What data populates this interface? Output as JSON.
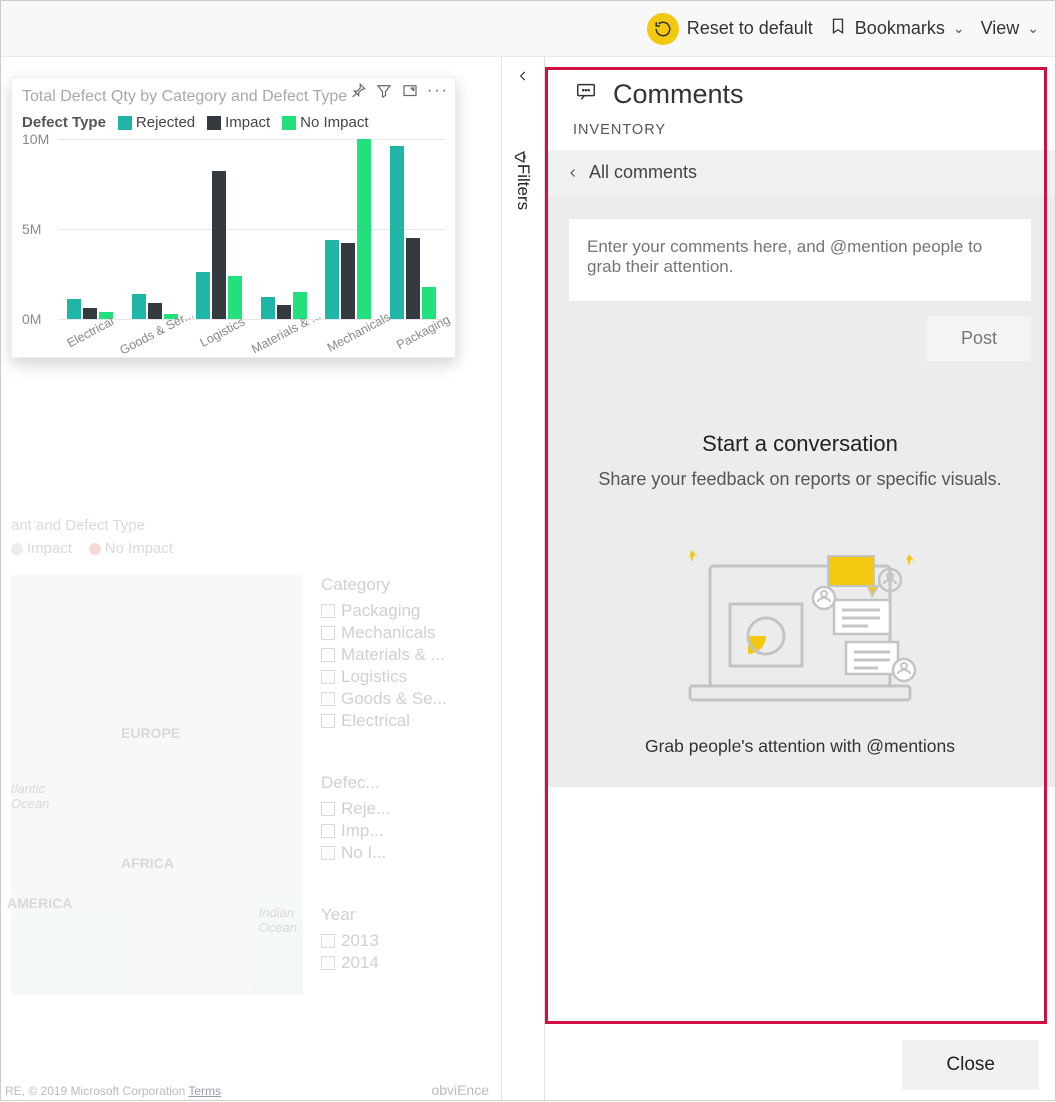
{
  "topbar": {
    "reset": "Reset to default",
    "bookmarks": "Bookmarks",
    "view": "View"
  },
  "rail": {
    "label": "Filters"
  },
  "card": {
    "title": "Total Defect Qty by Category and Defect Type",
    "legend_label": "Defect Type",
    "series_names": {
      "rejected": "Rejected",
      "impact": "Impact",
      "noimpact": "No Impact"
    }
  },
  "chart_data": {
    "type": "bar",
    "title": "Total Defect Qty by Category and Defect Type",
    "categories": [
      "Electrical",
      "Goods & Ser...",
      "Logistics",
      "Materials & ...",
      "Mechanicals",
      "Packaging"
    ],
    "series": [
      {
        "name": "Rejected",
        "color": "#1fb5a7",
        "values": [
          1.1,
          1.4,
          2.6,
          1.2,
          4.4,
          9.6
        ]
      },
      {
        "name": "Impact",
        "color": "#343a40",
        "values": [
          0.6,
          0.9,
          8.2,
          0.8,
          4.2,
          4.5
        ]
      },
      {
        "name": "No Impact",
        "color": "#22e07b",
        "values": [
          0.4,
          0.3,
          2.4,
          1.5,
          10.0,
          1.8
        ]
      }
    ],
    "ylabel": "",
    "xlabel": "",
    "ylim": [
      0,
      10
    ],
    "yticks": [
      "0M",
      "5M",
      "10M"
    ]
  },
  "faded": {
    "legend_partial": {
      "impact": "Impact",
      "noimpact": "No Impact"
    },
    "title_fragment": "ant and Defect Type",
    "map_labels": {
      "europe": "EUROPE",
      "africa": "AFRICA",
      "america": "AMERICA",
      "atlantic": "tlantic",
      "ocean": "Ocean",
      "indian": "Indian",
      "indian_ocean": "Ocean"
    },
    "category_slicer": {
      "title": "Category",
      "items": [
        "Packaging",
        "Mechanicals",
        "Materials & ...",
        "Logistics",
        "Goods & Se...",
        "Electrical"
      ]
    },
    "defect_slicer": {
      "title": "Defec...",
      "items": [
        "Reje...",
        "Imp...",
        "No I..."
      ]
    },
    "year_slicer": {
      "title": "Year",
      "items": [
        "2013",
        "2014"
      ]
    },
    "credit_prefix": "RE, © 2019 Microsoft Corporation ",
    "credit_link": "Terms",
    "brand": "obviEnce"
  },
  "comments": {
    "title": "Comments",
    "subtitle": "INVENTORY",
    "all": "All comments",
    "placeholder": "Enter your comments here, and @mention people to grab their attention.",
    "post": "Post",
    "convo_title": "Start a conversation",
    "convo_body": "Share your feedback on reports or specific visuals.",
    "grab": "Grab people's attention with @mentions",
    "close": "Close"
  }
}
